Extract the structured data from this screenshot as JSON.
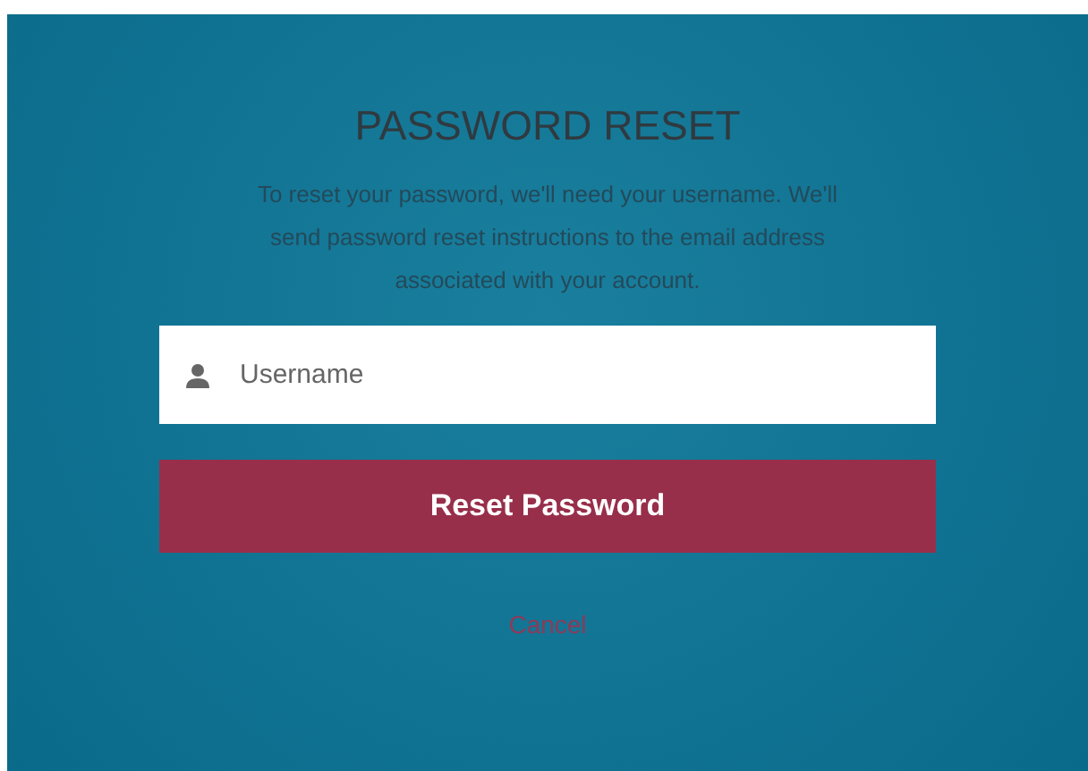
{
  "title": "PASSWORD RESET",
  "description": "To reset your password, we'll need your username. We'll send password reset instructions to the email address associated with your account.",
  "username_field": {
    "placeholder": "Username"
  },
  "submit_button": "Reset Password",
  "cancel_link": "Cancel"
}
